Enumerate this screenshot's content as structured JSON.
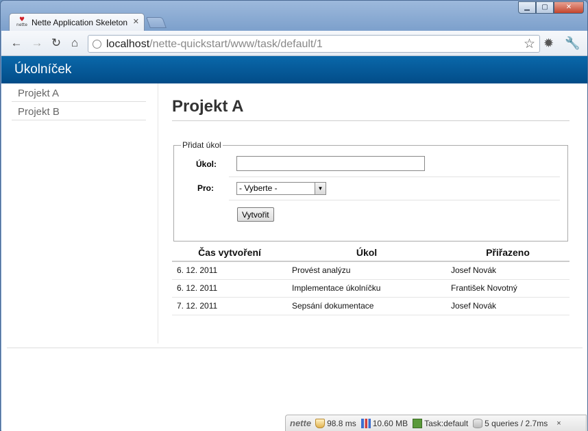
{
  "browser": {
    "tab_title": "Nette Application Skeleton",
    "favicon_text": "nette",
    "url_host": "localhost",
    "url_path": "/nette-quickstart/www/task/default/1"
  },
  "app": {
    "header_title": "Úkolníček",
    "sidebar": {
      "items": [
        {
          "label": "Projekt A"
        },
        {
          "label": "Projekt B"
        }
      ]
    },
    "page_title": "Projekt A",
    "form": {
      "legend": "Přidat úkol",
      "task_label": "Úkol:",
      "task_value": "",
      "for_label": "Pro:",
      "for_selected": "- Vyberte -",
      "submit_label": "Vytvořit"
    },
    "table": {
      "headers": [
        "Čas vytvoření",
        "Úkol",
        "Přiřazeno"
      ],
      "rows": [
        [
          "6. 12. 2011",
          "Provést analýzu",
          "Josef Novák"
        ],
        [
          "6. 12. 2011",
          "Implementace úkolníčku",
          "František Novotný"
        ],
        [
          "7. 12. 2011",
          "Sepsání dokumentace",
          "Josef Novák"
        ]
      ]
    }
  },
  "debug_bar": {
    "logo": "nette",
    "time": "98.8 ms",
    "memory": "10.60 MB",
    "presenter": "Task:default",
    "queries": "5 queries / 2.7ms",
    "close": "×"
  }
}
